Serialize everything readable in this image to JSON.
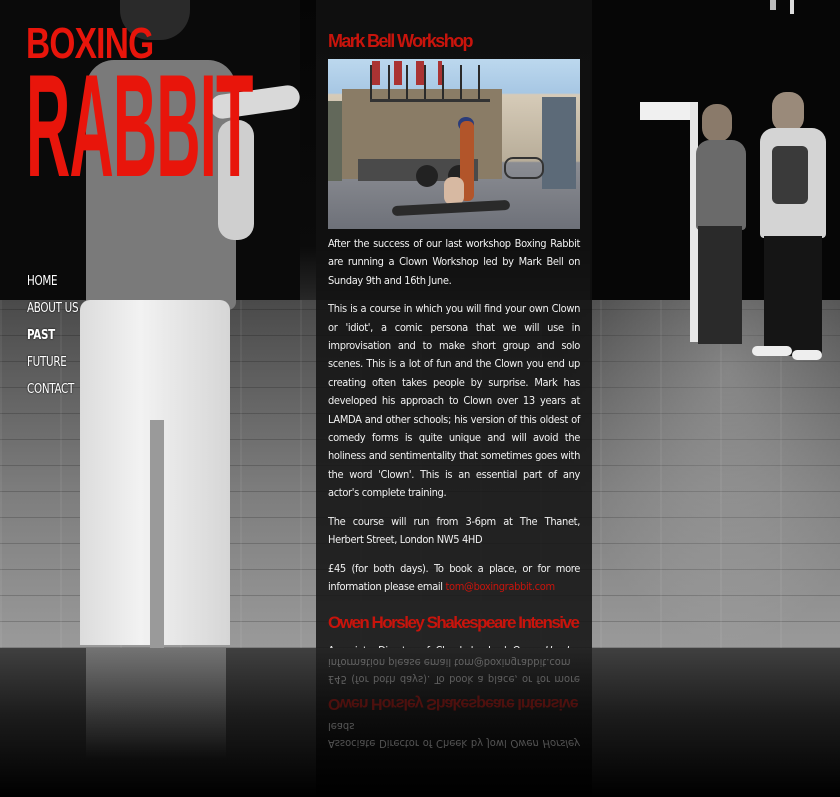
{
  "site": {
    "logo_line1": "BOXING",
    "logo_line2": "RABBIT",
    "brand_color": "#e8150b"
  },
  "nav": {
    "items": [
      {
        "label": "HOME"
      },
      {
        "label": "ABOUT US"
      },
      {
        "label": "PAST",
        "active": true
      },
      {
        "label": "FUTURE"
      },
      {
        "label": "CONTACT"
      }
    ]
  },
  "post1": {
    "title": "Mark Bell Workshop",
    "image_subject": "photo",
    "para1": "After the success of our last workshop Boxing Rabbit are running a Clown Workshop led by Mark Bell on Sunday 9th and 16th June.",
    "para2": "This is a course in which you will find your own Clown or 'idiot', a comic persona that we will use in improvisation and to make short group and solo scenes. This is a lot of fun and the Clown you end up creating often takes people by surprise. Mark has developed his approach to Clown over 13 years at LAMDA and other schools; his version of this oldest of comedy forms is quite unique and will avoid the holiness and sentimentality that sometimes goes with the word 'Clown'. This is an essential part of any actor's complete training.",
    "para3": "The course will run from 3-6pm at The Thanet, Herbert Street, London NW5 4HD",
    "para4": "£45 (for both days). To book a place, or for more information please email",
    "email": "tom@boxingrabbit.com"
  },
  "post2": {
    "title": "Owen Horsley Shakespeare Intensive",
    "para1_start": "Associate Director of Cheek by Jowl",
    "para1_name": "Owen Horsley",
    "para1_end": "leads"
  },
  "colors": {
    "accent": "#c8140c",
    "panel_bg": "#121212",
    "text": "#f1f1f1"
  }
}
